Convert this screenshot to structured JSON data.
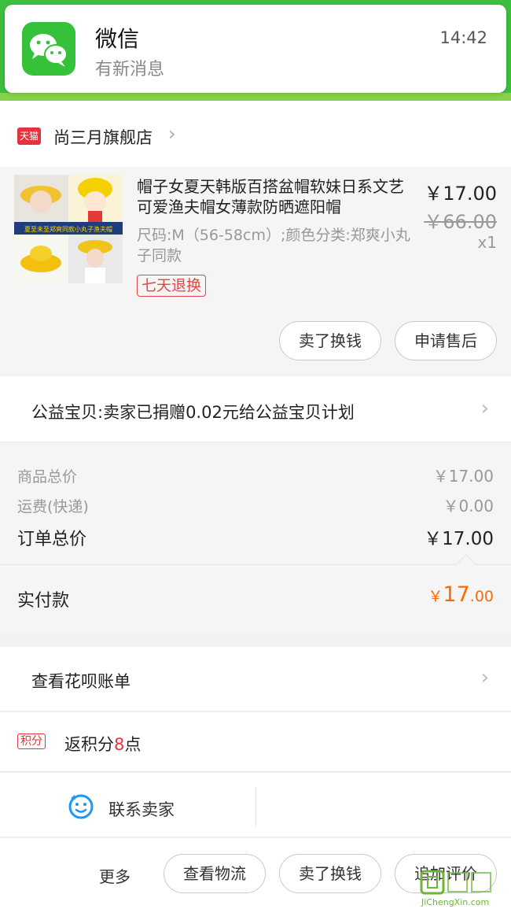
{
  "notification": {
    "app_name": "微信",
    "message": "有新消息",
    "time": "14:42"
  },
  "store": {
    "badge": "天猫",
    "name": "尚三月旗舰店"
  },
  "product": {
    "title": "帽子女夏天韩版百搭盆帽软妹日系文艺可爱渔夫帽女薄款防晒遮阳帽",
    "spec": "尺码:M（56-58cm）;颜色分类:郑爽小丸子同款",
    "tag": "七天退换",
    "price": "￥17.00",
    "original_price": "￥66.00",
    "quantity": "x1",
    "thumbnail_caption": "夏至未至郑爽同款小丸子渔夫帽",
    "actions": {
      "sell_label": "卖了换钱",
      "after_sale_label": "申请售后"
    }
  },
  "charity": {
    "text": "公益宝贝:卖家已捐赠0.02元给公益宝贝计划"
  },
  "totals": {
    "goods_label": "商品总价",
    "goods_value": "￥17.00",
    "shipping_label": "运费(快递)",
    "shipping_value": "￥0.00",
    "order_label": "订单总价",
    "order_value": "￥17.00"
  },
  "payment": {
    "label": "实付款",
    "currency": "￥",
    "amount_int": "17",
    "amount_dec": ".00"
  },
  "huabei": {
    "text": "查看花呗账单"
  },
  "points": {
    "badge": "积分",
    "prefix": "返积分",
    "value": "8",
    "suffix": "点"
  },
  "contact": {
    "label": "联系卖家"
  },
  "bottom_bar": {
    "more": "更多",
    "logistics": "查看物流",
    "sell": "卖了换钱",
    "review": "追加评价"
  },
  "watermark": {
    "text": "JiChengXin.com"
  },
  "colors": {
    "header_green": "#3cbf3c",
    "wechat_green": "#35c23a",
    "tmall_red": "#e6323c",
    "paid_orange": "#ff6a00"
  }
}
